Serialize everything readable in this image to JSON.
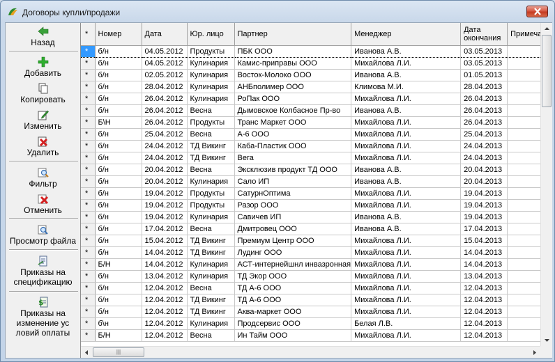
{
  "window": {
    "title": "Договоры купли/продажи"
  },
  "toolbar": {
    "back": "Назад",
    "add": "Добавить",
    "copy": "Копировать",
    "edit": "Изменить",
    "delete": "Удалить",
    "filter": "Фильтр",
    "cancel": "Отменить",
    "view_file": "Просмотр файла",
    "spec_orders": [
      "Приказы на",
      "спецификацию"
    ],
    "payment_orders": [
      "Приказы на",
      "изменение ус",
      "ловий оплаты"
    ]
  },
  "table": {
    "columns": [
      "*",
      "Номер",
      "Дата",
      "Юр. лицо",
      "Партнер",
      "Менеджер",
      "Дата окончания",
      "Примеча"
    ],
    "rows": [
      [
        "*",
        "б/н",
        "04.05.2012",
        "Продукты",
        "ПБК ООО",
        "Иванова А.В.",
        "03.05.2013",
        ""
      ],
      [
        "*",
        "б/н",
        "04.05.2012",
        "Кулинария",
        "Камис-приправы ООО",
        "Михайлова Л.И.",
        "03.05.2013",
        ""
      ],
      [
        "*",
        "б/н",
        "02.05.2012",
        "Кулинария",
        "Восток-Молоко ООО",
        "Иванова А.В.",
        "01.05.2013",
        ""
      ],
      [
        "*",
        "б/н",
        "28.04.2012",
        "Кулинария",
        "АНБполимер ООО",
        "Климова М.И.",
        "28.04.2013",
        ""
      ],
      [
        "*",
        "б/н",
        "26.04.2012",
        "Кулинария",
        "РоПак ООО",
        "Михайлова Л.И.",
        "26.04.2013",
        ""
      ],
      [
        "*",
        "б/н",
        "26.04.2012",
        "Весна",
        "Дымовское Колбасное Пр-во",
        "Иванова А.В.",
        "26.04.2013",
        ""
      ],
      [
        "*",
        "Б\\Н",
        "26.04.2012",
        "Продукты",
        "Транс Маркет ООО",
        "Михайлова Л.И.",
        "26.04.2013",
        ""
      ],
      [
        "*",
        "б/н",
        "25.04.2012",
        "Весна",
        "А-6 ООО",
        "Михайлова Л.И.",
        "25.04.2013",
        ""
      ],
      [
        "*",
        "б/н",
        "24.04.2012",
        "ТД Викинг",
        "Каба-Пластик ООО",
        "Михайлова Л.И.",
        "24.04.2013",
        ""
      ],
      [
        "*",
        "б/н",
        "24.04.2012",
        "ТД Викинг",
        "Вега",
        "Михайлова Л.И.",
        "24.04.2013",
        ""
      ],
      [
        "*",
        "б/н",
        "20.04.2012",
        "Весна",
        "Эксклюзив продукт ТД ООО",
        "Иванова А.В.",
        "20.04.2013",
        ""
      ],
      [
        "*",
        "б/н",
        "20.04.2012",
        "Кулинария",
        "Сало ИП",
        "Иванова А.В.",
        "20.04.2013",
        ""
      ],
      [
        "*",
        "б/н",
        "19.04.2012",
        "Продукты",
        "СатурнОптима",
        "Михайлова Л.И.",
        "19.04.2013",
        ""
      ],
      [
        "*",
        "б/н",
        "19.04.2012",
        "Продукты",
        "Разор ООО",
        "Михайлова Л.И.",
        "19.04.2013",
        ""
      ],
      [
        "*",
        "б/н",
        "19.04.2012",
        "Кулинария",
        "Савичев ИП",
        "Иванова А.В.",
        "19.04.2013",
        ""
      ],
      [
        "*",
        "б/н",
        "17.04.2012",
        "Весна",
        "Дмитровец ООО",
        "Иванова А.В.",
        "17.04.2013",
        ""
      ],
      [
        "*",
        "б/н",
        "15.04.2012",
        "ТД Викинг",
        "Премиум Центр ООО",
        "Михайлова Л.И.",
        "15.04.2013",
        ""
      ],
      [
        "*",
        "б/н",
        "14.04.2012",
        "ТД Викинг",
        "Лудинг ООО",
        "Михайлова Л.И.",
        "14.04.2013",
        ""
      ],
      [
        "*",
        "Б/Н",
        "14.04.2012",
        "Кулинария",
        "АСТ-интернейшнл инвазронная",
        "Михайлова Л.И.",
        "14.04.2013",
        ""
      ],
      [
        "*",
        "б/н",
        "13.04.2012",
        "Кулинария",
        "ТД Экор ООО",
        "Михайлова Л.И.",
        "13.04.2013",
        ""
      ],
      [
        "*",
        "б/н",
        "12.04.2012",
        "Весна",
        "ТД А-6 ООО",
        "Михайлова Л.И.",
        "12.04.2013",
        ""
      ],
      [
        "*",
        "б/н",
        "12.04.2012",
        "ТД Викинг",
        "ТД А-6 ООО",
        "Михайлова Л.И.",
        "12.04.2013",
        ""
      ],
      [
        "*",
        "б/н",
        "12.04.2012",
        "ТД Викинг",
        "Аква-маркет ООО",
        "Михайлова Л.И.",
        "12.04.2013",
        ""
      ],
      [
        "*",
        "б\\н",
        "12.04.2012",
        "Кулинария",
        "Продсервис ООО",
        "Белая Л.В.",
        "12.04.2013",
        ""
      ],
      [
        "*",
        "Б/Н",
        "12.04.2012",
        "Весна",
        "Ин Тайм ООО",
        "Михайлова Л.И.",
        "12.04.2013",
        ""
      ]
    ],
    "selected_row": 0
  },
  "colors": {
    "selection": "#3399ff",
    "title_bg": "#c9d8ea",
    "close_red": "#c43b22"
  }
}
